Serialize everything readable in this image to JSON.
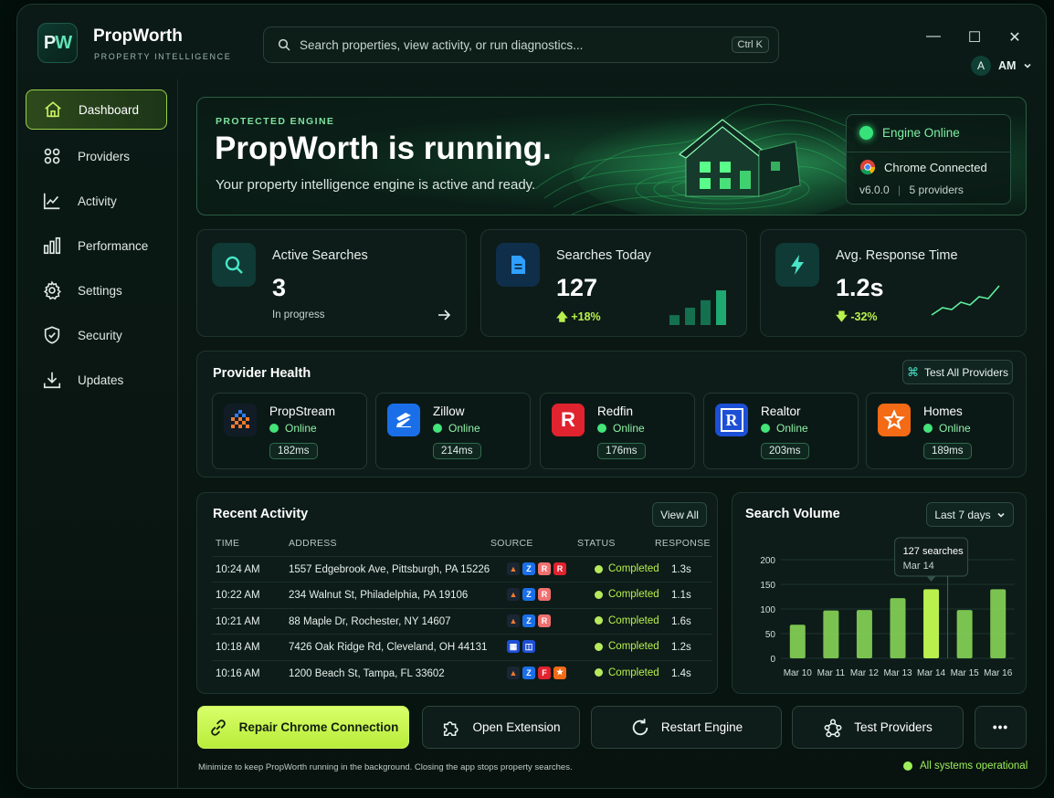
{
  "app": {
    "logo_p": "P",
    "logo_w": "W",
    "name": "PropWorth",
    "tagline": "PROPERTY INTELLIGENCE"
  },
  "search": {
    "placeholder": "Search properties, view activity, or run diagnostics...",
    "shortcut": "Ctrl K"
  },
  "window_controls": {
    "minimize": "—",
    "maximize": "☐",
    "close": "✕"
  },
  "user": {
    "avatar_letter": "A",
    "initials": "AM"
  },
  "sidebar": {
    "items": [
      {
        "label": "Dashboard",
        "icon": "home-icon",
        "active": true
      },
      {
        "label": "Providers",
        "icon": "grid-icon"
      },
      {
        "label": "Activity",
        "icon": "activity-chart-icon"
      },
      {
        "label": "Performance",
        "icon": "bar-chart-icon"
      },
      {
        "label": "Settings",
        "icon": "gear-icon"
      },
      {
        "label": "Security",
        "icon": "shield-icon"
      },
      {
        "label": "Updates",
        "icon": "download-icon"
      }
    ]
  },
  "hero": {
    "kicker": "PROTECTED ENGINE",
    "title": "PropWorth is running.",
    "subtitle": "Your property intelligence engine is active and ready.",
    "engine_status": "Engine Online",
    "chrome_status": "Chrome Connected",
    "version": "v6.0.0",
    "providers": "5 providers"
  },
  "stats": {
    "active": {
      "label": "Active Searches",
      "value": "3",
      "foot": "In progress"
    },
    "today": {
      "label": "Searches Today",
      "value": "127",
      "delta": "+18%",
      "spark": [
        4,
        7,
        10,
        14
      ]
    },
    "response": {
      "label": "Avg. Response Time",
      "value": "1.2s",
      "delta": "-32%"
    }
  },
  "provider_health": {
    "title": "Provider Health",
    "test_all": "Test All Providers",
    "providers": [
      {
        "name": "PropStream",
        "status": "Online",
        "ms": "182ms",
        "color": "#1a2a3a"
      },
      {
        "name": "Zillow",
        "status": "Online",
        "ms": "214ms",
        "color": "#1a6fe8"
      },
      {
        "name": "Redfin",
        "status": "Online",
        "ms": "176ms",
        "color": "#e1232f",
        "letter": "R"
      },
      {
        "name": "Realtor",
        "status": "Online",
        "ms": "203ms",
        "color": "#1d4fd6",
        "letter": "R"
      },
      {
        "name": "Homes",
        "status": "Online",
        "ms": "189ms",
        "color": "#f46a15"
      }
    ]
  },
  "recent_activity": {
    "title": "Recent Activity",
    "view_all": "View All",
    "columns": [
      "TIME",
      "ADDRESS",
      "SOURCE",
      "STATUS",
      "RESPONSE"
    ],
    "rows": [
      {
        "time": "10:24 AM",
        "address": "1557 Edgebrook Ave, Pittsburgh, PA 15226",
        "sources": [
          "ps",
          "z",
          "r",
          "rr"
        ],
        "status": "Completed",
        "response": "1.3s"
      },
      {
        "time": "10:22 AM",
        "address": "234 Walnut St, Philadelphia, PA 19106",
        "sources": [
          "ps",
          "z",
          "r"
        ],
        "status": "Completed",
        "response": "1.1s"
      },
      {
        "time": "10:21 AM",
        "address": "88 Maple Dr, Rochester, NY 14607",
        "sources": [
          "ps",
          "z",
          "r"
        ],
        "status": "Completed",
        "response": "1.6s"
      },
      {
        "time": "10:18 AM",
        "address": "7426 Oak Ridge Rd, Cleveland, OH 44131",
        "sources": [
          "b1",
          "b2"
        ],
        "status": "Completed",
        "response": "1.2s"
      },
      {
        "time": "10:16 AM",
        "address": "1200 Beach St, Tampa, FL 33602",
        "sources": [
          "ps",
          "z",
          "f",
          "h"
        ],
        "status": "Completed",
        "response": "1.4s"
      }
    ]
  },
  "search_volume": {
    "title": "Search Volume",
    "range": "Last 7 days",
    "tooltip_value": "127 searches",
    "tooltip_date": "Mar 14"
  },
  "chart_data": {
    "type": "bar",
    "categories": [
      "Mar 10",
      "Mar 11",
      "Mar 12",
      "Mar 13",
      "Mar 14",
      "Mar 15",
      "Mar 16"
    ],
    "values": [
      68,
      97,
      98,
      122,
      140,
      98,
      140
    ],
    "ylim": [
      0,
      200
    ],
    "yticks": [
      0,
      50,
      100,
      150,
      200
    ],
    "highlight_index": 4,
    "grid": true
  },
  "actions": {
    "repair": "Repair Chrome Connection",
    "extension": "Open Extension",
    "restart": "Restart Engine",
    "test": "Test Providers",
    "more": "•••"
  },
  "footer": {
    "note": "Minimize to keep PropWorth running in the background. Closing the app stops property searches.",
    "status": "All systems operational"
  },
  "colors": {
    "accent": "#b9f04e",
    "online": "#43e47a",
    "bar": "#8fe05a",
    "bar_highlight": "#b9f04e"
  }
}
